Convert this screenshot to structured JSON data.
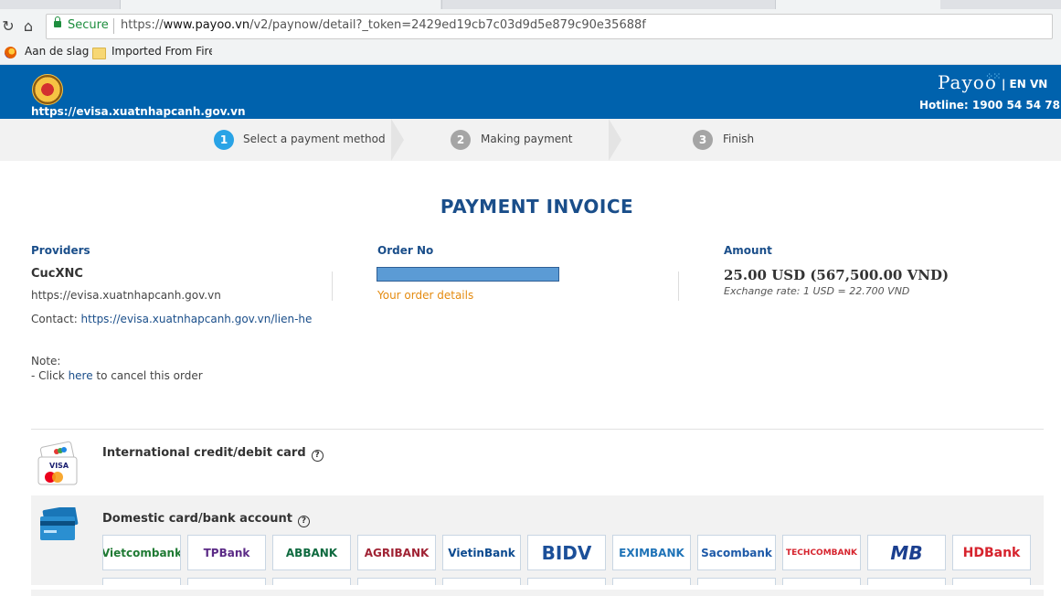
{
  "browser": {
    "secure_label": "Secure",
    "url_prefix": "https://",
    "url_host": "www.payoo.vn",
    "url_path": "/v2/paynow/detail?_token=2429ed19cb7c03d9d5e879c90e35688f",
    "bookmarks": [
      "Aan de slag",
      "Imported From Firefo"
    ]
  },
  "header": {
    "site_url": "https://evisa.xuatnhapcanh.gov.vn",
    "brand": "Payoo",
    "lang": "| EN VN",
    "hotline": "Hotline: 1900 54 54 78"
  },
  "steps": [
    {
      "num": "1",
      "label": "Select a payment method",
      "color": "#29a3e6"
    },
    {
      "num": "2",
      "label": "Making payment",
      "color": "#a5a5a5"
    },
    {
      "num": "3",
      "label": "Finish",
      "color": "#a5a5a5"
    }
  ],
  "invoice": {
    "title": "PAYMENT INVOICE",
    "providers_label": "Providers",
    "provider_name": "CucXNC",
    "provider_url": "https://evisa.xuatnhapcanh.gov.vn",
    "contact_label": "Contact: ",
    "contact_link": "https://evisa.xuatnhapcanh.gov.vn/lien-he",
    "order_label": "Order No",
    "order_details": "Your order details",
    "amount_label": "Amount",
    "amount_value": "25.00 USD (567,500.00 VND)",
    "exchange_rate": "Exchange rate: 1 USD = 22.700 VND",
    "note_label": "Note:",
    "note_prefix": "- Click ",
    "note_link": "here",
    "note_suffix": " to cancel this order"
  },
  "methods": {
    "international": "International credit/debit card",
    "domestic": "Domestic card/bank account",
    "help_glyph": "?"
  },
  "banks": [
    {
      "name": "Vietcombank",
      "color": "#1f7a33"
    },
    {
      "name": "TPBank",
      "color": "#5b2a86"
    },
    {
      "name": "ABBANK",
      "color": "#0e6a3f"
    },
    {
      "name": "AGRIBANK",
      "color": "#a02334"
    },
    {
      "name": "VietinBank",
      "color": "#0c4a8f"
    },
    {
      "name": "BIDV",
      "color": "#1b4f99"
    },
    {
      "name": "EXIMBANK",
      "color": "#1f73b7"
    },
    {
      "name": "Sacombank",
      "color": "#1e5aa8"
    },
    {
      "name": "TECHCOMBANK",
      "color": "#d6232d"
    },
    {
      "name": "MB",
      "color": "#1b3f8f"
    },
    {
      "name": "HDBank",
      "color": "#d6232d"
    }
  ]
}
